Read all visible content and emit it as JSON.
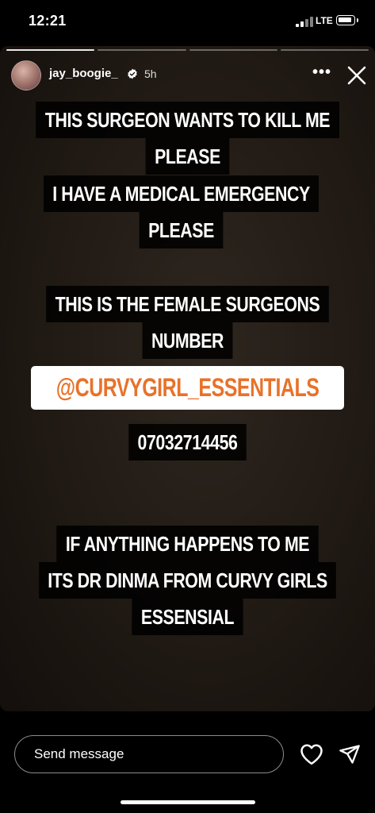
{
  "status_bar": {
    "time": "12:21",
    "network": "LTE"
  },
  "story": {
    "progress_segments": 4,
    "active_segment": 1,
    "username": "jay_boogie_",
    "verified": true,
    "time_ago": "5h",
    "more_icon": "more-horizontal-icon",
    "close_icon": "close-icon",
    "text_blocks": [
      [
        "THIS SURGEON WANTS TO KILL ME",
        "PLEASE"
      ],
      [
        "I HAVE A MEDICAL EMERGENCY",
        "PLEASE"
      ],
      [
        "THIS IS THE FEMALE SURGEONS",
        "NUMBER"
      ],
      [
        "07032714456"
      ],
      [
        "IF ANYTHING HAPPENS TO ME",
        "ITS DR DINMA FROM CURVY GIRLS",
        "ESSENSIAL"
      ]
    ],
    "mention": "@CURVYGIRL_ESSENTIALS",
    "mention_color": "#e8722a"
  },
  "reply_bar": {
    "placeholder": "Send message",
    "like_icon": "heart-icon",
    "share_icon": "send-icon"
  }
}
